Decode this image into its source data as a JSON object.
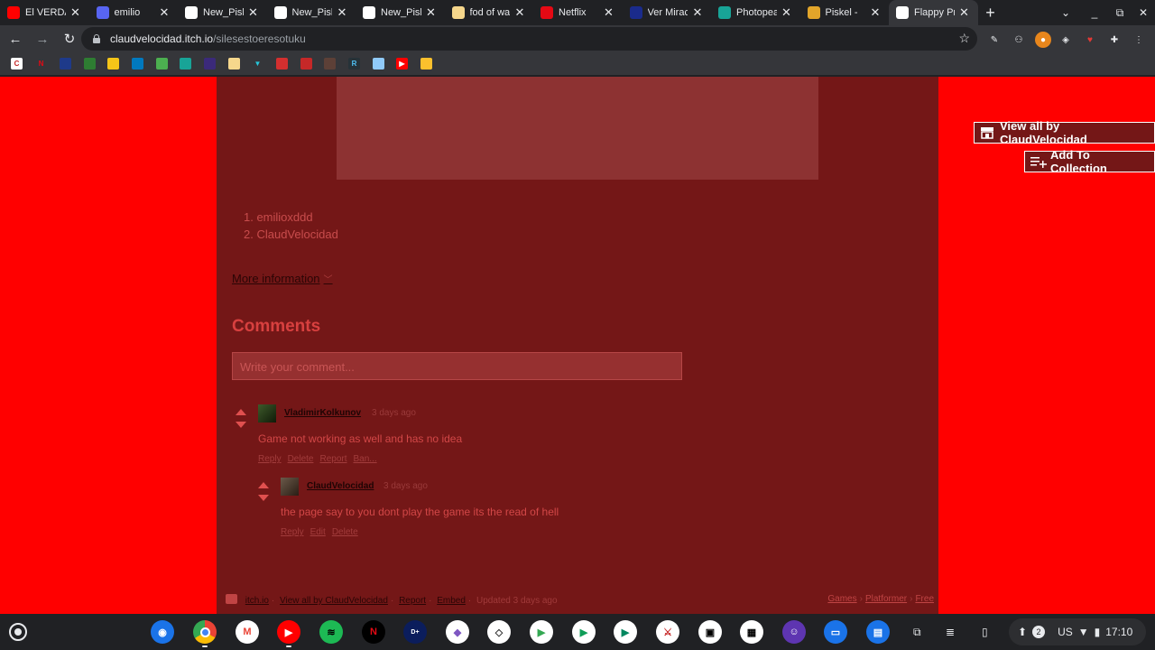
{
  "browser": {
    "tabs": [
      {
        "label": "El VERDAD",
        "favicon": "youtube-icon",
        "color": "#ff0000"
      },
      {
        "label": "emilio",
        "favicon": "discord-icon",
        "color": "#5865f2"
      },
      {
        "label": "New_Pisk",
        "favicon": "globe-icon",
        "color": "#ffffff"
      },
      {
        "label": "New_Pisk",
        "favicon": "globe-icon",
        "color": "#ffffff"
      },
      {
        "label": "New_Pisk",
        "favicon": "globe-icon",
        "color": "#ffffff"
      },
      {
        "label": "fod of wa",
        "favicon": "egg-icon",
        "color": "#f6d78c"
      },
      {
        "label": "Netflix",
        "favicon": "netflix-icon",
        "color": "#e50914"
      },
      {
        "label": "Ver Miracu",
        "favicon": "disney-icon",
        "color": "#1a2b8c"
      },
      {
        "label": "Photopea",
        "favicon": "photopea-icon",
        "color": "#18a497"
      },
      {
        "label": "Piskel -",
        "favicon": "piskel-icon",
        "color": "#e2a52a"
      },
      {
        "label": "Flappy Pro",
        "favicon": "blank-page-icon",
        "color": "#ffffff"
      }
    ],
    "url_host": "claudvelocidad.itch.io",
    "url_path": "/silesestoeresotuku"
  },
  "page": {
    "authors": [
      "1. emilioxddd",
      "2. ClaudVelocidad"
    ],
    "more_info_label": "More information",
    "comments_title": "Comments",
    "comment_placeholder": "Write your comment...",
    "comments": [
      {
        "user": "VladimirKolkunov",
        "time": "3 days ago",
        "text": "Game not working as well and has no idea",
        "actions": [
          "Reply",
          "Delete",
          "Report",
          "Ban..."
        ]
      },
      {
        "user": "ClaudVelocidad",
        "time": "3 days ago",
        "text": "the page say to you dont play the game its the read of hell",
        "actions": [
          "Reply",
          "Edit",
          "Delete"
        ]
      }
    ],
    "footer": {
      "site": "itch.io",
      "view_all": "View all by ClaudVelocidad",
      "report": "Report",
      "embed": "Embed",
      "updated": "Updated 3 days ago",
      "tags": [
        "Games",
        "Platformer",
        "Free"
      ]
    },
    "view_all_button": "View all by ClaudVelocidad",
    "add_collection_button": "Add To Collection",
    "background_color": "#ff0000",
    "column_color": "#741717"
  },
  "shelf": {
    "locale": "US",
    "notifications": "2",
    "time": "17:10"
  }
}
